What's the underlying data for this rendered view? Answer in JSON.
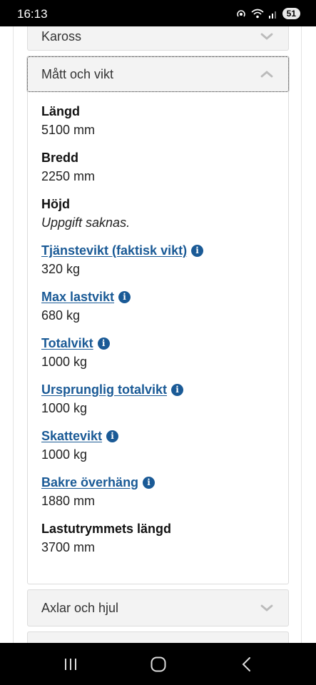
{
  "status": {
    "time": "16:13",
    "battery": "51"
  },
  "accordions": {
    "kaross": {
      "label": "Kaross",
      "expanded": false
    },
    "matt": {
      "label": "Mått och vikt",
      "expanded": true
    },
    "axlar": {
      "label": "Axlar och hjul",
      "expanded": false
    }
  },
  "fields": [
    {
      "label": "Längd",
      "value": "5100 mm",
      "link": false,
      "info": false
    },
    {
      "label": "Bredd",
      "value": "2250 mm",
      "link": false,
      "info": false
    },
    {
      "label": "Höjd",
      "value": "Uppgift saknas.",
      "link": false,
      "info": false
    },
    {
      "label": "Tjänstevikt (faktisk vikt)",
      "value": "320 kg",
      "link": true,
      "info": true
    },
    {
      "label": "Max lastvikt",
      "value": "680 kg",
      "link": true,
      "info": true
    },
    {
      "label": "Totalvikt",
      "value": "1000 kg",
      "link": true,
      "info": true
    },
    {
      "label": "Ursprunglig totalvikt",
      "value": "1000 kg",
      "link": true,
      "info": true
    },
    {
      "label": "Skattevikt",
      "value": "1000 kg",
      "link": true,
      "info": true
    },
    {
      "label": "Bakre överhäng",
      "value": "1880 mm",
      "link": true,
      "info": true
    },
    {
      "label": "Lastutrymmets längd",
      "value": "3700 mm",
      "link": false,
      "info": false
    }
  ],
  "icons": {
    "info": "info-icon",
    "chevron_up": "chevron-up-icon",
    "chevron_down": "chevron-down-icon",
    "nav_recent": "recent-apps-icon",
    "nav_home": "home-icon",
    "nav_back": "back-icon"
  },
  "colors": {
    "link": "#1a5a96",
    "header_bg": "#f3f3f3",
    "border": "#dcdcdc"
  }
}
